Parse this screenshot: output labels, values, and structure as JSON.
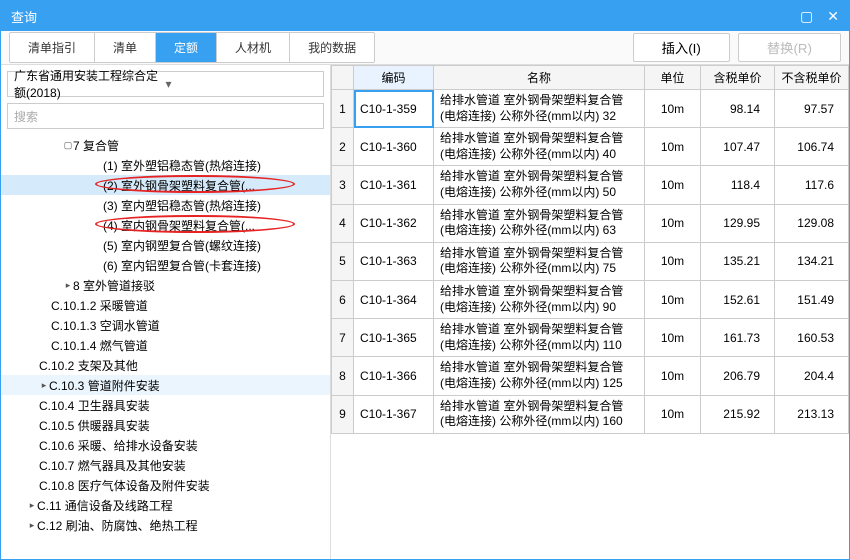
{
  "window": {
    "title": "查询"
  },
  "tabs": [
    "清单指引",
    "清单",
    "定额",
    "人材机",
    "我的数据"
  ],
  "activeTab": 2,
  "buttons": {
    "insert": "插入(I)",
    "replace": "替换(R)"
  },
  "combo": "广东省通用安装工程综合定额(2018)",
  "searchPlaceholder": "搜索",
  "tree": [
    {
      "indent": 62,
      "caret": "▢",
      "label": "7 复合管"
    },
    {
      "indent": 102,
      "label": "(1) 室外塑铝稳态管(热熔连接)"
    },
    {
      "indent": 102,
      "label": "(2) 室外钢骨架塑料复合管(...",
      "selected": true,
      "ellipse": true
    },
    {
      "indent": 102,
      "label": "(3) 室内塑铝稳态管(热熔连接)"
    },
    {
      "indent": 102,
      "label": "(4) 室内钢骨架塑料复合管(...",
      "ellipse": true
    },
    {
      "indent": 102,
      "label": "(5) 室内钢塑复合管(螺纹连接)"
    },
    {
      "indent": 102,
      "label": "(6) 室内铝塑复合管(卡套连接)"
    },
    {
      "indent": 62,
      "caret": "▸",
      "label": "8 室外管道接驳"
    },
    {
      "indent": 50,
      "label": "C.10.1.2 采暖管道"
    },
    {
      "indent": 50,
      "label": "C.10.1.3 空调水管道"
    },
    {
      "indent": 50,
      "label": "C.10.1.4 燃气管道"
    },
    {
      "indent": 38,
      "label": "C.10.2 支架及其他"
    },
    {
      "indent": 38,
      "caret": "▸",
      "label": "C.10.3 管道附件安装",
      "parentSel": true
    },
    {
      "indent": 38,
      "label": "C.10.4 卫生器具安装"
    },
    {
      "indent": 38,
      "label": "C.10.5 供暖器具安装"
    },
    {
      "indent": 38,
      "label": "C.10.6 采暖、给排水设备安装"
    },
    {
      "indent": 38,
      "label": "C.10.7 燃气器具及其他安装"
    },
    {
      "indent": 38,
      "label": "C.10.8 医疗气体设备及附件安装"
    },
    {
      "indent": 26,
      "caret": "▸",
      "label": "C.11 通信设备及线路工程"
    },
    {
      "indent": 26,
      "caret": "▸",
      "label": "C.12 刷油、防腐蚀、绝热工程"
    }
  ],
  "grid": {
    "headers": [
      "",
      "编码",
      "名称",
      "单位",
      "含税单价",
      "不含税单价"
    ],
    "rows": [
      {
        "n": "1",
        "code": "C10-1-359",
        "name": "给排水管道 室外钢骨架塑料复合管(电熔连接) 公称外径(mm以内) 32",
        "unit": "10m",
        "p1": "98.14",
        "p2": "97.57"
      },
      {
        "n": "2",
        "code": "C10-1-360",
        "name": "给排水管道 室外钢骨架塑料复合管(电熔连接) 公称外径(mm以内) 40",
        "unit": "10m",
        "p1": "107.47",
        "p2": "106.74"
      },
      {
        "n": "3",
        "code": "C10-1-361",
        "name": "给排水管道 室外钢骨架塑料复合管(电熔连接) 公称外径(mm以内) 50",
        "unit": "10m",
        "p1": "118.4",
        "p2": "117.6"
      },
      {
        "n": "4",
        "code": "C10-1-362",
        "name": "给排水管道 室外钢骨架塑料复合管(电熔连接) 公称外径(mm以内) 63",
        "unit": "10m",
        "p1": "129.95",
        "p2": "129.08"
      },
      {
        "n": "5",
        "code": "C10-1-363",
        "name": "给排水管道 室外钢骨架塑料复合管(电熔连接) 公称外径(mm以内) 75",
        "unit": "10m",
        "p1": "135.21",
        "p2": "134.21"
      },
      {
        "n": "6",
        "code": "C10-1-364",
        "name": "给排水管道 室外钢骨架塑料复合管(电熔连接) 公称外径(mm以内) 90",
        "unit": "10m",
        "p1": "152.61",
        "p2": "151.49"
      },
      {
        "n": "7",
        "code": "C10-1-365",
        "name": "给排水管道 室外钢骨架塑料复合管(电熔连接) 公称外径(mm以内) 110",
        "unit": "10m",
        "p1": "161.73",
        "p2": "160.53"
      },
      {
        "n": "8",
        "code": "C10-1-366",
        "name": "给排水管道 室外钢骨架塑料复合管(电熔连接) 公称外径(mm以内) 125",
        "unit": "10m",
        "p1": "206.79",
        "p2": "204.4"
      },
      {
        "n": "9",
        "code": "C10-1-367",
        "name": "给排水管道 室外钢骨架塑料复合管(电熔连接) 公称外径(mm以内) 160",
        "unit": "10m",
        "p1": "215.92",
        "p2": "213.13"
      }
    ]
  }
}
